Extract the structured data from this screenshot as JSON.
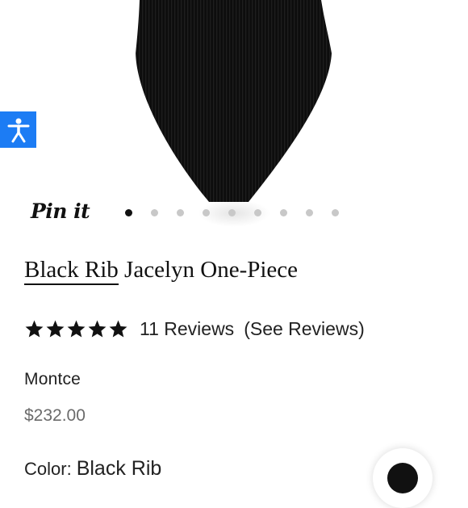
{
  "product": {
    "title_brand": "Black Rib",
    "title_rest": " Jacelyn One-Piece",
    "brand": "Montce",
    "price": "$232.00",
    "color_label": "Color:",
    "color_value": "Black Rib"
  },
  "rating": {
    "stars": 5,
    "reviews_count": "11 Reviews",
    "see_reviews": "(See Reviews)"
  },
  "gallery": {
    "pin_label": "Pin it",
    "image_count": 9,
    "active_index": 0
  },
  "icons": {
    "accessibility": "accessibility-icon",
    "chat": "chat-icon",
    "star": "star-icon"
  },
  "colors": {
    "accent": "#1c7cf4",
    "text": "#111111",
    "price": "#6b6b6b",
    "dot_inactive": "#c8c8c8"
  }
}
